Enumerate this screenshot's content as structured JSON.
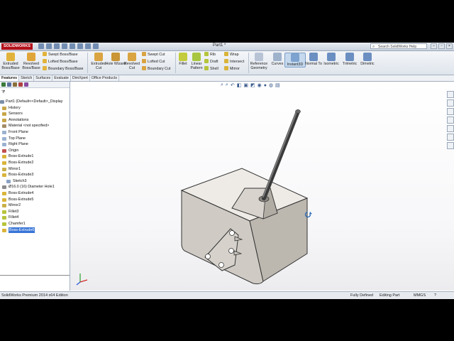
{
  "app": {
    "logo": "SOLIDWORKS",
    "doc_title": "Part1 *",
    "search_placeholder": "Search SolidWorks Help"
  },
  "ribbon": {
    "extruded_boss": "Extruded Boss/Base",
    "revolved_boss": "Revolved Boss/Base",
    "swept_boss": "Swept Boss/Base",
    "lofted_boss": "Lofted Boss/Base",
    "boundary_boss": "Boundary Boss/Base",
    "extruded_cut": "Extruded Cut",
    "hole_wizard": "Hole Wizard",
    "revolved_cut": "Revolved Cut",
    "swept_cut": "Swept Cut",
    "lofted_cut": "Lofted Cut",
    "boundary_cut": "Boundary Cut",
    "fillet": "Fillet",
    "linear_pattern": "Linear Pattern",
    "rib": "Rib",
    "draft": "Draft",
    "shell": "Shell",
    "wrap": "Wrap",
    "intersect": "Intersect",
    "mirror": "Mirror",
    "reference_geometry": "Reference Geometry",
    "curves": "Curves",
    "instant3d": "Instant3D",
    "normal_to": "Normal To",
    "isometric": "Isometric",
    "trimetric": "Trimetric",
    "dimetric": "Dimetric"
  },
  "tabs": [
    "Features",
    "Sketch",
    "Surfaces",
    "Evaluate",
    "DimXpert",
    "Office Products"
  ],
  "tree": [
    "Part1  (Default<<Default>_Display",
    "History",
    "Sensors",
    "Annotations",
    "Material <not specified>",
    "Front Plane",
    "Top Plane",
    "Right Plane",
    "Origin",
    "Boss-Extrude1",
    "Boss-Extrude2",
    "Mirror1",
    "Boss-Extrude3",
    "Sketch3",
    "Ø16.0 (16) Diameter Hole1",
    "Boss-Extrude4",
    "Boss-Extrude5",
    "Mirror2",
    "Fillet3",
    "Fillet4",
    "Chamfer1",
    "Boss-Extrude6"
  ],
  "status": {
    "edition": "SolidWorks Premium 2014 x64 Edition",
    "definition": "Fully Defined",
    "mode": "Editing Part",
    "units": "MMGS"
  },
  "colors": {
    "accent": "#3875d7",
    "body_front": "#cfcbc4",
    "body_top": "#eeebe6",
    "body_right": "#bdb8b0",
    "rod": "#5a5a5a"
  }
}
